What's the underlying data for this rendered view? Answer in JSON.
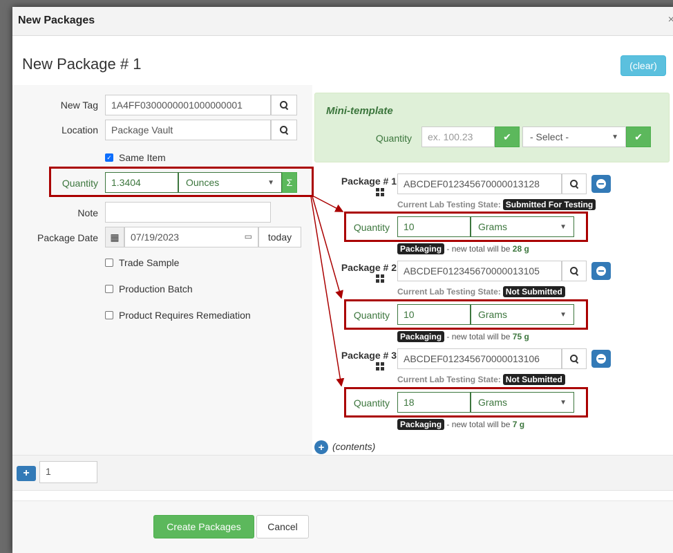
{
  "header": {
    "title": "New Packages",
    "close": "×"
  },
  "section_title": "New Package # 1",
  "clear_label": "(clear)",
  "form": {
    "new_tag_label": "New Tag",
    "new_tag_value": "1A4FF0300000001000000001",
    "location_label": "Location",
    "location_value": "Package Vault",
    "same_item_label": "Same Item",
    "quantity_label": "Quantity",
    "quantity_value": "1.3404",
    "quantity_unit": "Ounces",
    "sum_symbol": "Σ",
    "note_label": "Note",
    "note_value": "",
    "package_date_label": "Package Date",
    "package_date_value": "07/19/2023",
    "today_label": "today",
    "trade_sample_label": "Trade Sample",
    "production_batch_label": "Production Batch",
    "remediation_label": "Product Requires Remediation"
  },
  "mini_template": {
    "title": "Mini-template",
    "quantity_label": "Quantity",
    "quantity_placeholder": "ex. 100.23",
    "select_value": "- Select -"
  },
  "packages": [
    {
      "label": "Package # 1",
      "tag": "ABCDEF012345670000013128",
      "lab_state_label": "Current Lab Testing State:",
      "lab_state": "Submitted For Testing",
      "quantity_label": "Quantity",
      "quantity": "10",
      "unit": "Grams",
      "packaging_badge": "Packaging",
      "note_prefix": "- new total will be",
      "total": "28 g"
    },
    {
      "label": "Package # 2",
      "tag": "ABCDEF012345670000013105",
      "lab_state_label": "Current Lab Testing State:",
      "lab_state": "Not Submitted",
      "quantity_label": "Quantity",
      "quantity": "10",
      "unit": "Grams",
      "packaging_badge": "Packaging",
      "note_prefix": "- new total will be",
      "total": "75 g"
    },
    {
      "label": "Package # 3",
      "tag": "ABCDEF012345670000013106",
      "lab_state_label": "Current Lab Testing State:",
      "lab_state": "Not Submitted",
      "quantity_label": "Quantity",
      "quantity": "18",
      "unit": "Grams",
      "packaging_badge": "Packaging",
      "note_prefix": "- new total will be",
      "total": "7 g"
    }
  ],
  "contents_label": "(contents)",
  "add_count": "1",
  "create_label": "Create Packages",
  "cancel_label": "Cancel",
  "colors": {
    "accent_blue": "#337ab7",
    "info": "#5bc0de",
    "success": "#5cb85c",
    "highlight": "#aa0000",
    "label_green": "#3c763d"
  }
}
